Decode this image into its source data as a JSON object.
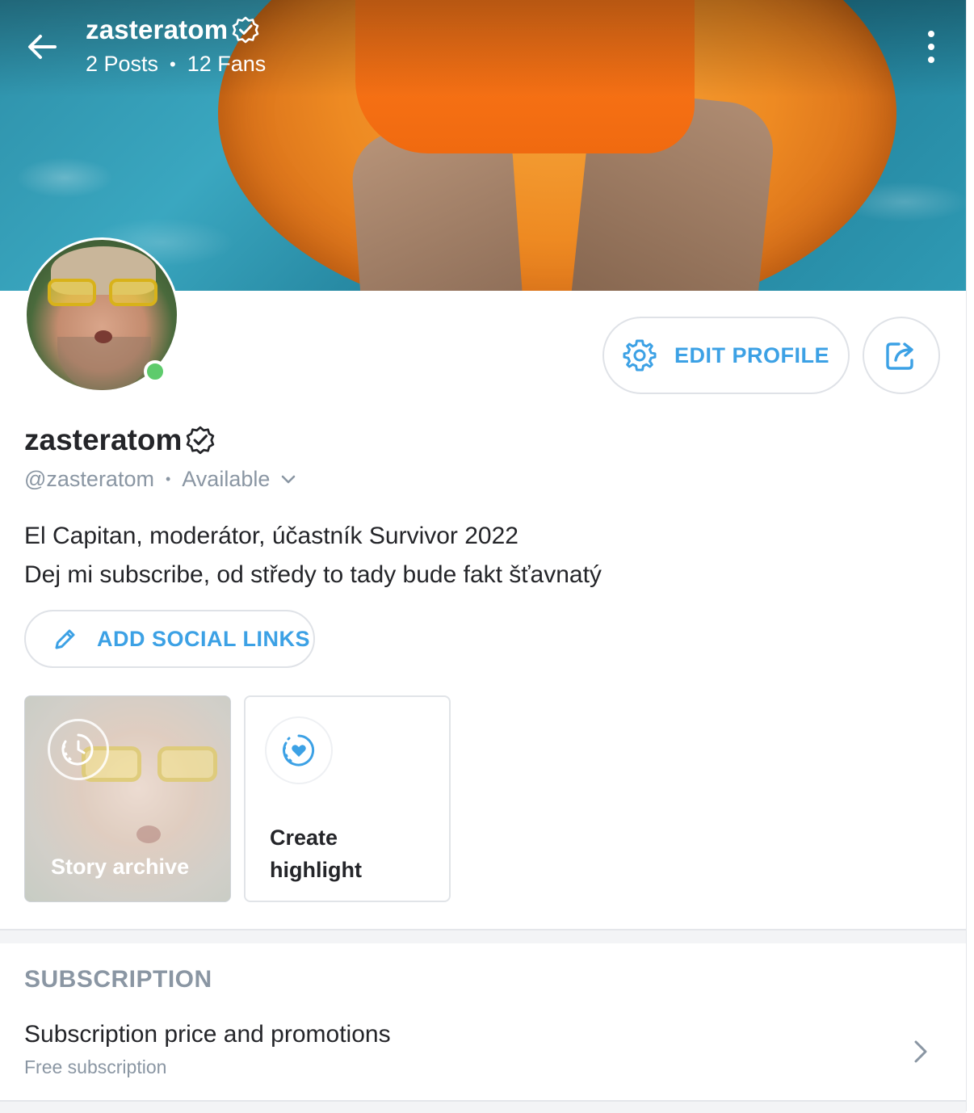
{
  "header": {
    "username": "zasteratom",
    "posts": "2 Posts",
    "separator": "•",
    "fans": "12 Fans"
  },
  "profile": {
    "display_name": "zasteratom",
    "handle": "@zasteratom",
    "separator": "•",
    "status": "Available",
    "online": true,
    "bio": [
      "El Capitan, moderátor, účastník Survivor 2022",
      "Dej mi subscribe, od středy to tady bude fakt šťavnatý"
    ]
  },
  "actions": {
    "edit_profile_label": "EDIT PROFILE",
    "add_social_links_label": "ADD SOCIAL LINKS"
  },
  "highlights": {
    "story_archive_label": "Story archive",
    "create_highlight_label": "Create highlight"
  },
  "subscription": {
    "section_title": "SUBSCRIPTION",
    "item_label": "Subscription price and promotions",
    "item_note": "Free subscription"
  },
  "colors": {
    "accent": "#3ca1e5",
    "online": "#5ecb6c",
    "muted_text": "#8a96a3"
  },
  "icons": [
    "back-arrow-icon",
    "verified-badge-icon",
    "more-vertical-icon",
    "gear-icon",
    "share-icon",
    "chevron-down-icon",
    "pencil-icon",
    "clock-icon",
    "heart-circle-icon",
    "chevron-right-icon"
  ]
}
